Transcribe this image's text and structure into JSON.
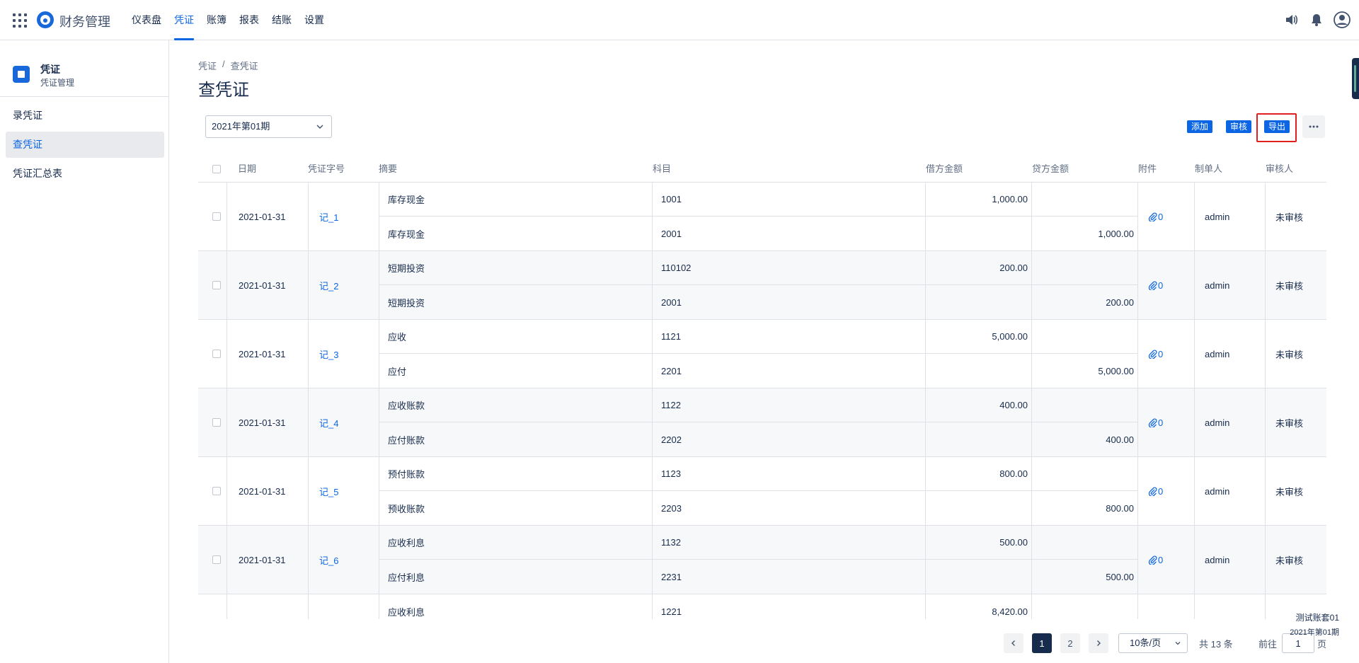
{
  "app": {
    "title": "财务管理"
  },
  "nav": {
    "items": [
      {
        "label": "仪表盘"
      },
      {
        "label": "凭证"
      },
      {
        "label": "账簿"
      },
      {
        "label": "报表"
      },
      {
        "label": "结账"
      },
      {
        "label": "设置"
      }
    ],
    "active_index": 1
  },
  "sidebar": {
    "title": "凭证",
    "subtitle": "凭证管理",
    "items": [
      {
        "label": "录凭证"
      },
      {
        "label": "查凭证"
      },
      {
        "label": "凭证汇总表"
      }
    ],
    "active_index": 1
  },
  "breadcrumb": {
    "root": "凭证",
    "sep": "/",
    "current": "查凭证"
  },
  "page": {
    "title": "查凭证"
  },
  "filter": {
    "period": "2021年第01期"
  },
  "toolbar": {
    "add_label": "添加",
    "audit_label": "审核",
    "export_label": "导出",
    "more_label": "···"
  },
  "table": {
    "headers": {
      "date": "日期",
      "voucher_no": "凭证字号",
      "summary": "摘要",
      "account": "科目",
      "debit": "借方金额",
      "credit": "贷方金额",
      "attachment": "附件",
      "maker": "制单人",
      "auditor": "审核人"
    },
    "rows": [
      {
        "date": "2021-01-31",
        "voucher_no": "记_1",
        "attachments": "0",
        "maker": "admin",
        "auditor": "未审核",
        "lines": [
          {
            "summary": "库存现金",
            "account": "1001",
            "debit": "1,000.00",
            "credit": ""
          },
          {
            "summary": "库存现金",
            "account": "2001",
            "debit": "",
            "credit": "1,000.00"
          }
        ]
      },
      {
        "date": "2021-01-31",
        "voucher_no": "记_2",
        "attachments": "0",
        "maker": "admin",
        "auditor": "未审核",
        "lines": [
          {
            "summary": "短期投资",
            "account": "110102",
            "debit": "200.00",
            "credit": ""
          },
          {
            "summary": "短期投资",
            "account": "2001",
            "debit": "",
            "credit": "200.00"
          }
        ]
      },
      {
        "date": "2021-01-31",
        "voucher_no": "记_3",
        "attachments": "0",
        "maker": "admin",
        "auditor": "未审核",
        "lines": [
          {
            "summary": "应收",
            "account": "1121",
            "debit": "5,000.00",
            "credit": ""
          },
          {
            "summary": "应付",
            "account": "2201",
            "debit": "",
            "credit": "5,000.00"
          }
        ]
      },
      {
        "date": "2021-01-31",
        "voucher_no": "记_4",
        "attachments": "0",
        "maker": "admin",
        "auditor": "未审核",
        "lines": [
          {
            "summary": "应收账款",
            "account": "1122",
            "debit": "400.00",
            "credit": ""
          },
          {
            "summary": "应付账款",
            "account": "2202",
            "debit": "",
            "credit": "400.00"
          }
        ]
      },
      {
        "date": "2021-01-31",
        "voucher_no": "记_5",
        "attachments": "0",
        "maker": "admin",
        "auditor": "未审核",
        "lines": [
          {
            "summary": "预付账款",
            "account": "1123",
            "debit": "800.00",
            "credit": ""
          },
          {
            "summary": "预收账款",
            "account": "2203",
            "debit": "",
            "credit": "800.00"
          }
        ]
      },
      {
        "date": "2021-01-31",
        "voucher_no": "记_6",
        "attachments": "0",
        "maker": "admin",
        "auditor": "未审核",
        "lines": [
          {
            "summary": "应收利息",
            "account": "1132",
            "debit": "500.00",
            "credit": ""
          },
          {
            "summary": "应付利息",
            "account": "2231",
            "debit": "",
            "credit": "500.00"
          }
        ]
      },
      {
        "date": "",
        "voucher_no": "",
        "attachments": "",
        "maker": "",
        "auditor": "",
        "lines": [
          {
            "summary": "应收利息",
            "account": "1221",
            "debit": "8,420.00",
            "credit": ""
          }
        ]
      }
    ]
  },
  "pagination": {
    "pages": [
      "1",
      "2"
    ],
    "current": "1",
    "page_size": "10条/页",
    "total": "共 13 条",
    "goto_label": "前往",
    "goto_value": "1",
    "goto_unit": "页"
  },
  "corner": {
    "account_set": "测试账套01",
    "period": "2021年第01期"
  },
  "colors": {
    "primary": "#0c66e4",
    "highlight": "#e02020",
    "text": "#172b4d"
  }
}
